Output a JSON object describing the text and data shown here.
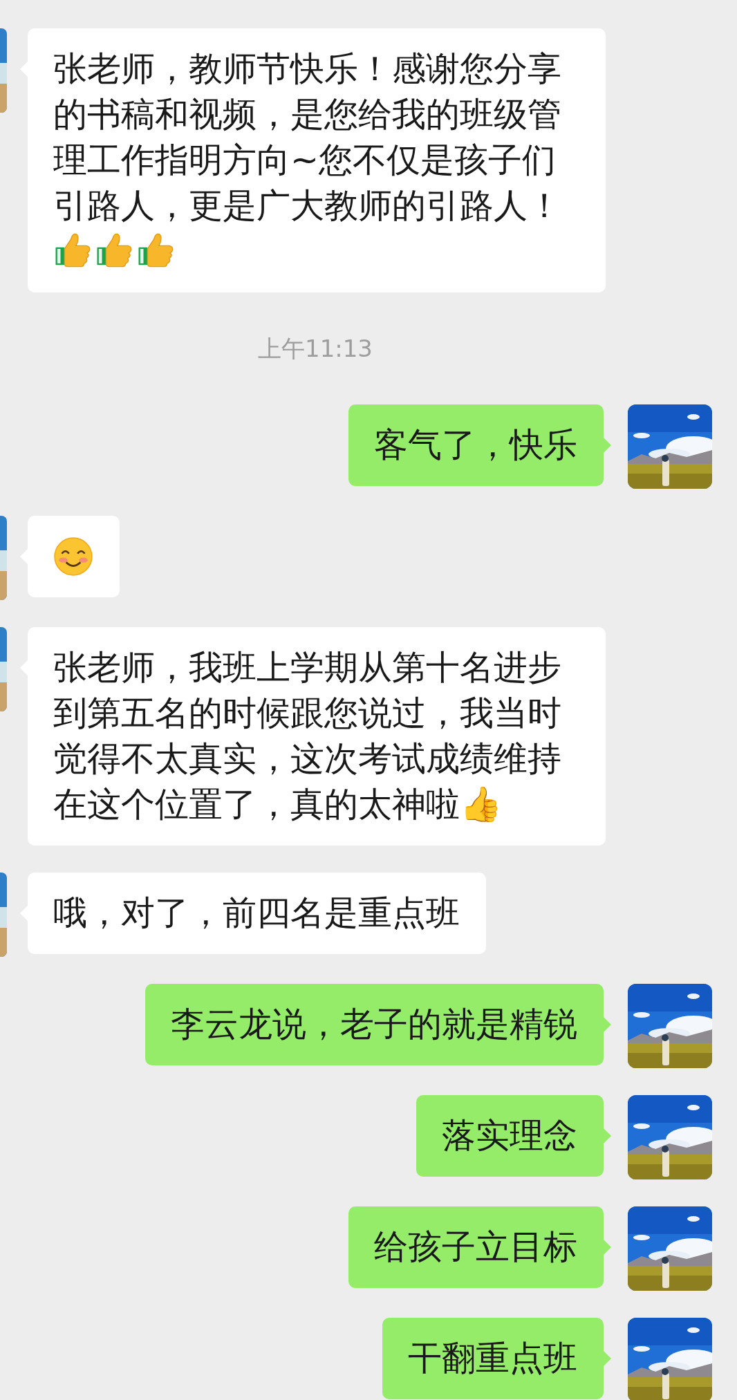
{
  "messages": [
    {
      "kind": "text",
      "outgoing": false,
      "text": "张老师，教师节快乐！感谢您分享的书稿和视频，是您给我的班级管理工作指明方向~您不仅是孩子们引路人，更是广大教师的引路人！",
      "emoji": [
        {
          "kind": "thumbs_up"
        },
        {
          "kind": "thumbs_up"
        },
        {
          "kind": "thumbs_up"
        }
      ]
    },
    {
      "kind": "time",
      "text": "上午11:13"
    },
    {
      "kind": "text",
      "outgoing": true,
      "text": "客气了，快乐"
    },
    {
      "kind": "emoji",
      "outgoing": false,
      "emoji": [
        {
          "kind": "smile"
        }
      ]
    },
    {
      "kind": "text",
      "outgoing": false,
      "text": "张老师，我班上学期从第十名进步到第五名的时候跟您说过，我当时觉得不太真实，这次考试成绩维持在这个位置了，真的太神啦👍"
    },
    {
      "kind": "text",
      "outgoing": false,
      "text": "哦，对了，前四名是重点班"
    },
    {
      "kind": "text",
      "outgoing": true,
      "text": "李云龙说，老子的就是精锐"
    },
    {
      "kind": "text",
      "outgoing": true,
      "text": "落实理念"
    },
    {
      "kind": "text",
      "outgoing": true,
      "text": "给孩子立目标"
    },
    {
      "kind": "text",
      "outgoing": true,
      "text": "干翻重点班"
    }
  ]
}
